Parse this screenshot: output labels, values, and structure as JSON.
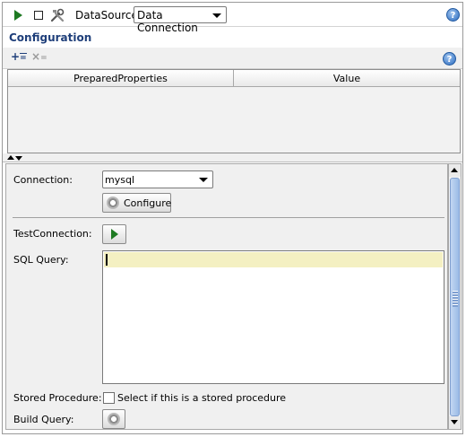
{
  "toolbar": {
    "run_icon": "play-icon",
    "stop_icon": "stop-icon",
    "tools_icon": "tools-icon",
    "datasource_label": "DataSource:",
    "datasource_value": "Data Connection",
    "help_icon": "help-icon"
  },
  "configuration": {
    "title": "Configuration",
    "add_icon": "add-row-icon",
    "remove_icon": "remove-row-icon",
    "help_icon": "help-icon",
    "table": {
      "columns": [
        "PreparedProperties",
        "Value"
      ],
      "rows": []
    }
  },
  "form": {
    "connection_label": "Connection:",
    "connection_value": "mysql",
    "configure_label": "Configure",
    "test_connection_label": "TestConnection:",
    "sql_query_label": "SQL Query:",
    "sql_query_value": "",
    "stored_procedure_label": "Stored Procedure:",
    "stored_procedure_checkbox_label": "Select if this is a stored procedure",
    "stored_procedure_checked": false,
    "build_query_label": "Build Query:"
  },
  "colors": {
    "accent_green": "#1e7a22",
    "title_blue": "#1f3f7a",
    "highlight_line": "#f4f0c2"
  }
}
